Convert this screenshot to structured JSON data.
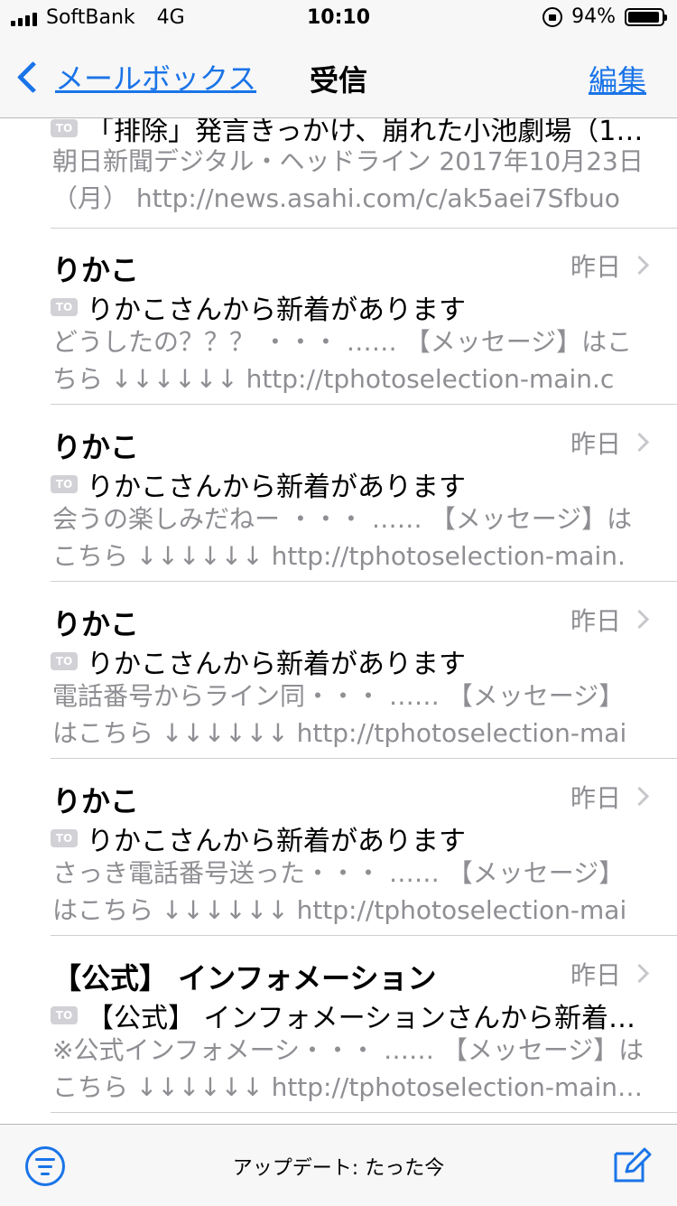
{
  "status_bar": {
    "carrier": "SoftBank",
    "network": "4G",
    "time": "10:10",
    "battery": "94%",
    "battery_level": 0.94
  },
  "nav": {
    "back_label": "メールボックス",
    "title": "受信",
    "edit_label": "編集"
  },
  "partial_item": {
    "badge": "TO",
    "subject": "「排除」発言きっかけ、崩れた小池劇場（10月…",
    "preview": "朝日新聞デジタル・ヘッドライン 2017年10月23日（月） http://news.asahi.com/c/ak5aei7Sfbuou…"
  },
  "messages": [
    {
      "sender": "りかこ",
      "date": "昨日",
      "badge": "TO",
      "subject": "りかこさんから新着があります",
      "preview": "どうしたの？？？ ・・・ …… 【メッセージ】はこちら ↓↓↓↓↓↓ http://tphotoselection-main.co…"
    },
    {
      "sender": "りかこ",
      "date": "昨日",
      "badge": "TO",
      "subject": "りかこさんから新着があります",
      "preview": "会うの楽しみだねー ・・・ …… 【メッセージ】はこちら ↓↓↓↓↓↓ http://tphotoselection-main.c…"
    },
    {
      "sender": "りかこ",
      "date": "昨日",
      "badge": "TO",
      "subject": "りかこさんから新着があります",
      "preview": "電話番号からライン同・・・ …… 【メッセージ】はこちら ↓↓↓↓↓↓ http://tphotoselection-main…"
    },
    {
      "sender": "りかこ",
      "date": "昨日",
      "badge": "TO",
      "subject": "りかこさんから新着があります",
      "preview": "さっき電話番号送った・・・ …… 【メッセージ】はこちら ↓↓↓↓↓↓ http://tphotoselection-main…"
    },
    {
      "sender": "【公式】 インフォメーション",
      "date": "昨日",
      "badge": "TO",
      "subject": "【公式】 インフォメーションさんから新着が…",
      "preview": "※公式インフォメーシ・・・ …… 【メッセージ】はこちら ↓↓↓↓↓↓ http://tphotoselection-main…"
    }
  ],
  "toolbar": {
    "update_status": "アップデート: たった今",
    "filter_icon": "filter-icon",
    "compose_icon": "compose-icon"
  },
  "colors": {
    "accent": "#1a74e8",
    "secondary_text": "#8e8e93"
  }
}
